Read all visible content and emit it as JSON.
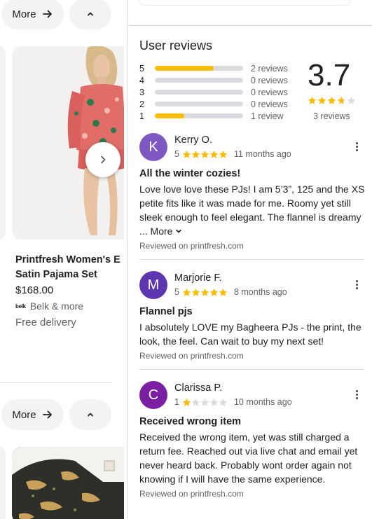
{
  "left": {
    "more_label_1": "More",
    "more_label_2": "More",
    "collapse_icon": "chevron-up-icon",
    "next_icon": "chevron-right-icon",
    "product": {
      "title_line_1": "Printfresh Women's E",
      "title_line_2": "Satin Pajama Set",
      "price": "$168.00",
      "store_logo": "belk",
      "store": "Belk & more",
      "delivery": "Free delivery"
    }
  },
  "reviews_panel": {
    "title": "User reviews",
    "score": "3.7",
    "score_value": 3.7,
    "review_count": "3 reviews",
    "distribution": [
      {
        "stars": "5",
        "count_label": "2 reviews",
        "fraction": 0.67
      },
      {
        "stars": "4",
        "count_label": "0 reviews",
        "fraction": 0
      },
      {
        "stars": "3",
        "count_label": "0 reviews",
        "fraction": 0
      },
      {
        "stars": "2",
        "count_label": "0 reviews",
        "fraction": 0
      },
      {
        "stars": "1",
        "count_label": "1 review",
        "fraction": 0.33
      }
    ],
    "reviews": [
      {
        "initial": "K",
        "avatar_color": "#7e57c2",
        "name": "Kerry O.",
        "rating": "5",
        "rating_value": 5,
        "date": "11 months ago",
        "title": "All the winter cozies!",
        "body": "Love love love these PJs! I am 5’3”, 125 and the XS petite fits like it was made for me. Roomy yet still sleek enough to feel elegant. The flannel is dreamy",
        "more": "... More",
        "source": "Reviewed on printfresh.com"
      },
      {
        "initial": "M",
        "avatar_color": "#5e35b1",
        "name": "Marjorie F.",
        "rating": "5",
        "rating_value": 5,
        "date": "8 months ago",
        "title": "Flannel pjs",
        "body": "I absolutely LOVE my Bagheera PJs - the print, the look, the feel. Can wait to buy my next set!",
        "source": "Reviewed on printfresh.com"
      },
      {
        "initial": "C",
        "avatar_color": "#7b1fa2",
        "name": "Clarissa P.",
        "rating": "1",
        "rating_value": 1,
        "date": "10 months ago",
        "title": "Received wrong item",
        "body": "Received the wrong item, yet was still charged a return fee. Reached out via live chat and email yet never heard back. Probably wont order again not knowing if I will have the same experience.",
        "source": "Reviewed on printfresh.com"
      }
    ]
  },
  "colors": {
    "star": "#fbbc04",
    "star_empty": "#dadce0",
    "bar_track": "#dadce0"
  }
}
